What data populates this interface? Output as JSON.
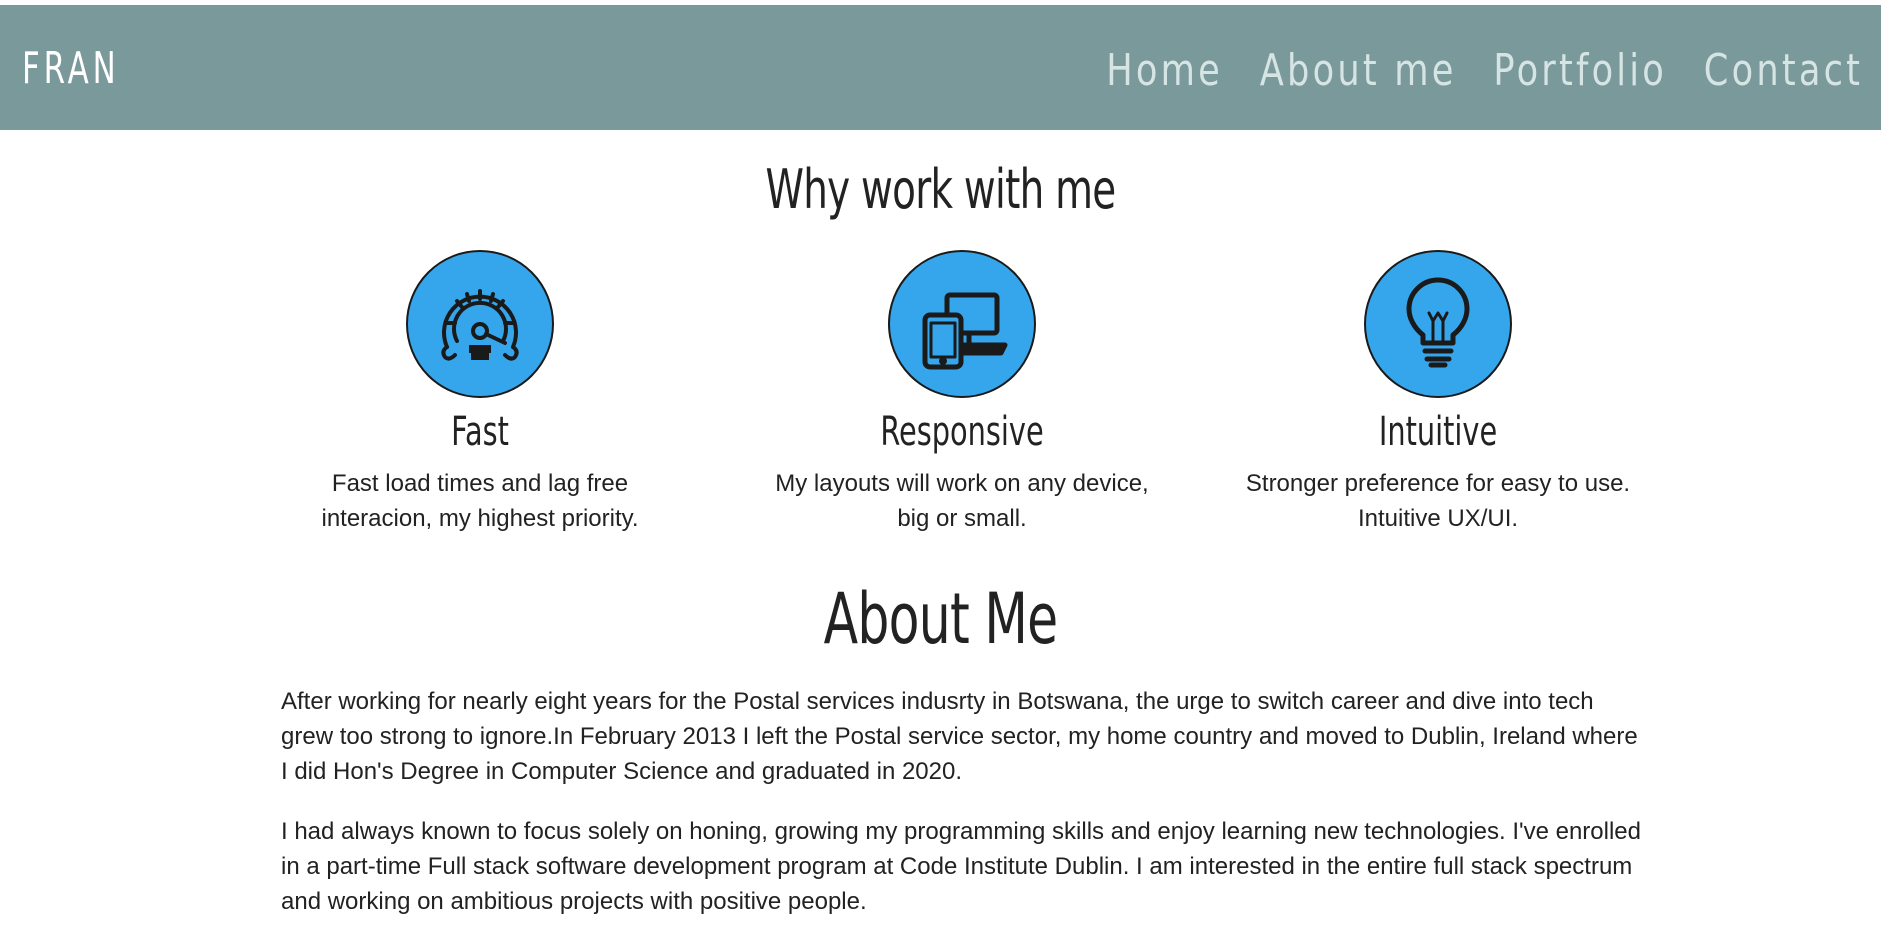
{
  "header": {
    "brand": "FRAN",
    "nav": [
      "Home",
      "About me",
      "Portfolio",
      "Contact"
    ]
  },
  "why": {
    "title": "Why work with me",
    "features": [
      {
        "icon": "speedometer-icon",
        "title": "Fast",
        "line1": "Fast load times and lag free",
        "line2": "interacion, my highest priority."
      },
      {
        "icon": "devices-icon",
        "title": "Responsive",
        "line1": "My layouts will work on any device,",
        "line2": "big or small."
      },
      {
        "icon": "lightbulb-icon",
        "title": "Intuitive",
        "line1": "Stronger preference for easy to use.",
        "line2": "Intuitive UX/UI."
      }
    ]
  },
  "about": {
    "title": "About Me",
    "paragraphs": [
      "After working for nearly eight years for the Postal services indusrty in Botswana, the urge to switch career and dive into tech grew too strong to ignore.In February 2013 I left the Postal service sector, my home country and moved to Dublin, Ireland where I did Hon's Degree in Computer Science and graduated in 2020.",
      "I had always known to focus solely on honing, growing my programming skills and enjoy learning new technologies. I've enrolled in a part-time Full stack software development program at Code Institute Dublin. I am interested in the entire full stack spectrum and working on ambitious projects with positive people."
    ]
  },
  "colors": {
    "header_bg": "#7a999a",
    "nav_text": "#d6e4e4",
    "icon_circle": "#36a6ec"
  }
}
